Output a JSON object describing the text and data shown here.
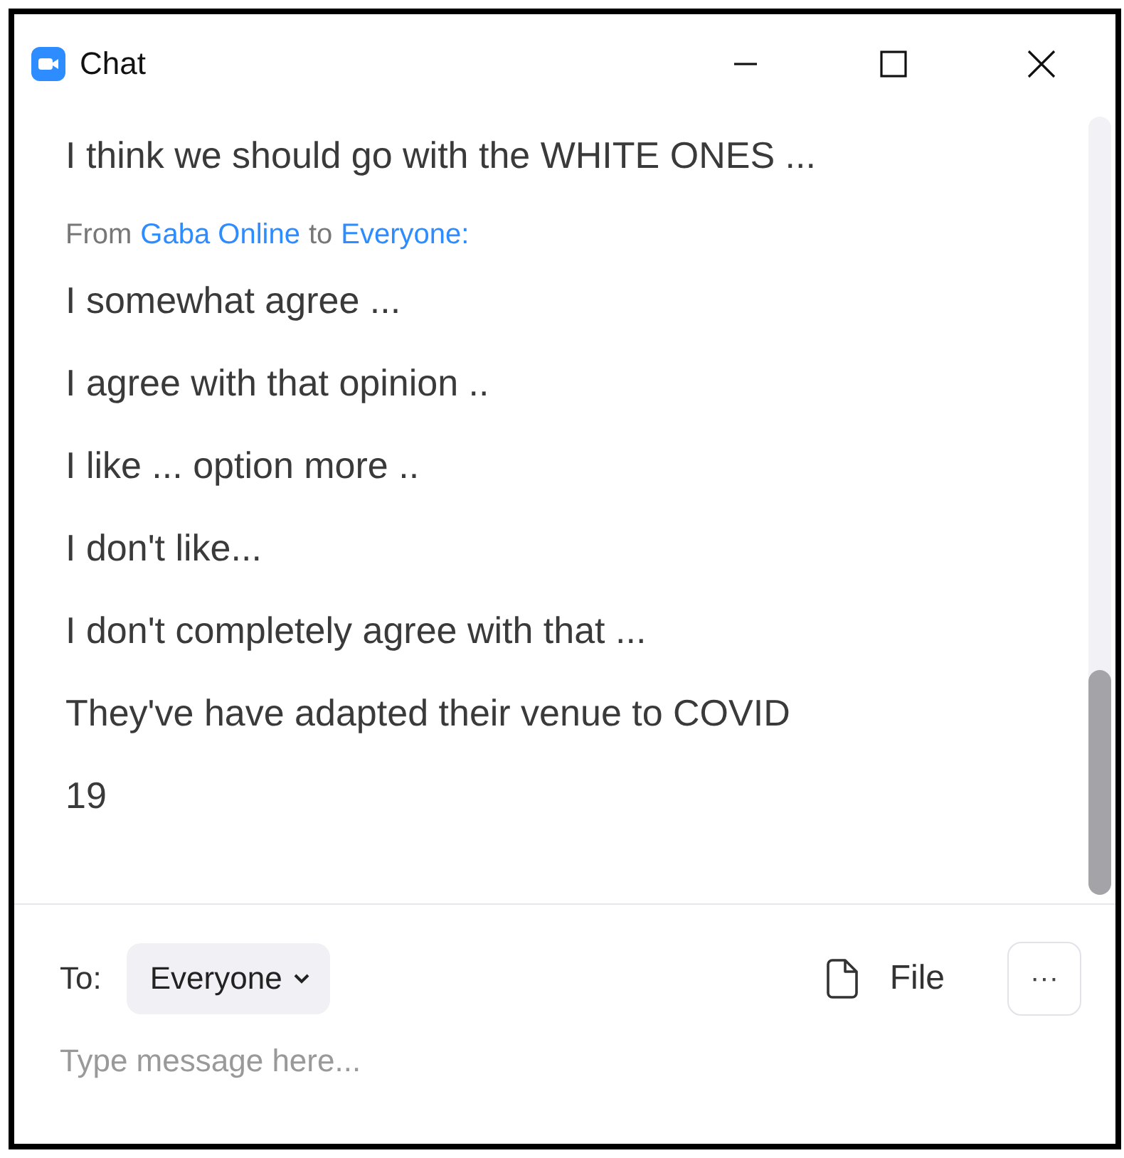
{
  "window": {
    "title": "Chat"
  },
  "messages": [
    {
      "kind": "text",
      "text": "I think we should go with the WHITE ONES ..."
    },
    {
      "kind": "header",
      "from_label": "From",
      "sender": "Gaba Online",
      "to_label": "to",
      "recipient": "Everyone",
      "suffix": ":"
    },
    {
      "kind": "text",
      "text": "I somewhat agree ..."
    },
    {
      "kind": "text",
      "text": "I agree with that opinion .."
    },
    {
      "kind": "text",
      "text": "I like ... option more .."
    },
    {
      "kind": "text",
      "text": "I don't like..."
    },
    {
      "kind": "text",
      "text": "I don't completely agree with that ..."
    },
    {
      "kind": "text",
      "text": "They've have adapted their venue to COVID 19"
    }
  ],
  "composer": {
    "to_label": "To:",
    "recipient": "Everyone",
    "file_label": "File",
    "more": "···",
    "placeholder": "Type message here..."
  }
}
